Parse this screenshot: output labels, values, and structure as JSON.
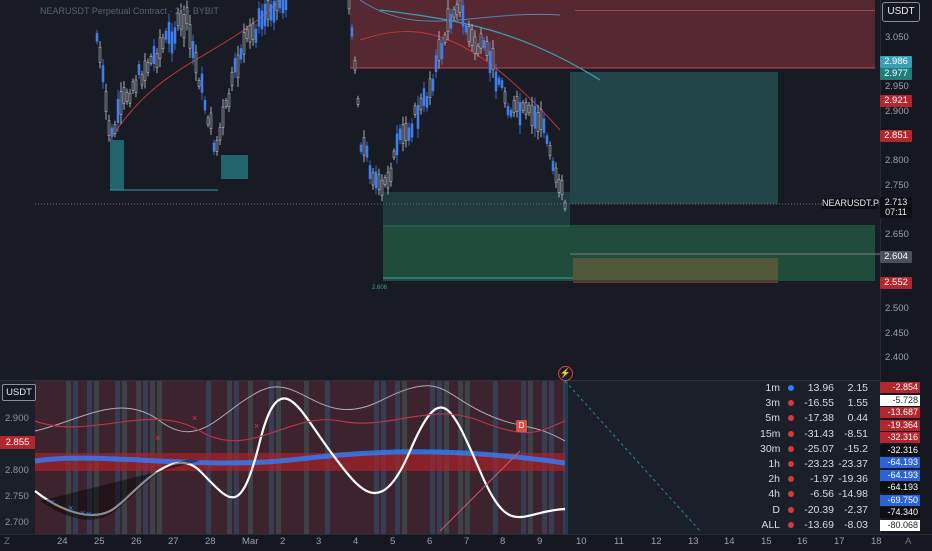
{
  "chart": {
    "title": "NEARUSDT Perpetual Contract · 2h · BYBIT",
    "currency_button": "USDT",
    "symbol_badge": "NEARUSDT.P",
    "current_price": "2.713",
    "countdown": "07:11",
    "liq_label": "2.606"
  },
  "price_axis": {
    "ticks": [
      "3.050",
      "2.950",
      "2.900",
      "2.800",
      "2.750",
      "2.650",
      "2.500",
      "2.450",
      "2.400"
    ],
    "labels": [
      {
        "text": "2.986",
        "color": "#3a9fb5"
      },
      {
        "text": "2.977",
        "color": "#1f7d7a"
      },
      {
        "text": "2.921",
        "color": "#b3262e"
      },
      {
        "text": "2.851",
        "color": "#b3262e"
      },
      {
        "text": "2.604",
        "color": "#4b505c"
      },
      {
        "text": "2.552",
        "color": "#b3262e"
      }
    ]
  },
  "oscillator": {
    "currency_button": "USDT",
    "ticks": [
      "2.900",
      "2.800",
      "2.750",
      "2.700"
    ],
    "price_label": "2.855",
    "d_marker": "D",
    "axis_values": [
      {
        "text": "-2.854",
        "color": "#b3262e"
      },
      {
        "text": "-5.728",
        "color": "#ffffff",
        "text_color": "#222"
      },
      {
        "text": "-13.687",
        "color": "#b3262e"
      },
      {
        "text": "-19.364",
        "color": "#b3262e"
      },
      {
        "text": "-32.316",
        "color": "#b3262e"
      },
      {
        "text": "-32.316",
        "color": "#0d0f14"
      },
      {
        "text": "-64.193",
        "color": "#2a62d8"
      },
      {
        "text": "-64.193",
        "color": "#2a62d8"
      },
      {
        "text": "-64.193",
        "color": "#0d0f14"
      },
      {
        "text": "-69.750",
        "color": "#2a62d8"
      },
      {
        "text": "-74.340",
        "color": "#0d0f14"
      },
      {
        "text": "-80.068",
        "color": "#ffffff",
        "text_color": "#222"
      }
    ]
  },
  "mtf_table": [
    {
      "tf": "1m",
      "dot": "#2a7fff",
      "v1": "13.96",
      "v2": "2.15"
    },
    {
      "tf": "3m",
      "dot": "#d43a3a",
      "v1": "-16.55",
      "v2": "1.55"
    },
    {
      "tf": "5m",
      "dot": "#d43a3a",
      "v1": "-17.38",
      "v2": "0.44"
    },
    {
      "tf": "15m",
      "dot": "#d43a3a",
      "v1": "-31.43",
      "v2": "-8.51"
    },
    {
      "tf": "30m",
      "dot": "#d43a3a",
      "v1": "-25.07",
      "v2": "-15.2"
    },
    {
      "tf": "1h",
      "dot": "#d43a3a",
      "v1": "-23.23",
      "v2": "-23.37"
    },
    {
      "tf": "2h",
      "dot": "#d43a3a",
      "v1": "-1.97",
      "v2": "-19.36"
    },
    {
      "tf": "4h",
      "dot": "#d43a3a",
      "v1": "-6.56",
      "v2": "-14.98"
    },
    {
      "tf": "D",
      "dot": "#d43a3a",
      "v1": "-20.39",
      "v2": "-2.37"
    },
    {
      "tf": "ALL",
      "dot": "#d43a3a",
      "v1": "-13.69",
      "v2": "-8.03"
    }
  ],
  "time_axis": [
    "24",
    "25",
    "26",
    "27",
    "28",
    "Mar",
    "2",
    "3",
    "4",
    "5",
    "6",
    "7",
    "8",
    "9",
    "10",
    "11",
    "12",
    "13",
    "14",
    "15",
    "16",
    "17",
    "18"
  ],
  "time_axis_edges": {
    "left": "Z",
    "right": "A"
  },
  "colors": {
    "bull": "#3f7ef0",
    "bear": "#6f7584",
    "supply_zone": "#c9434d",
    "demand_zone": "#2e8a78"
  }
}
